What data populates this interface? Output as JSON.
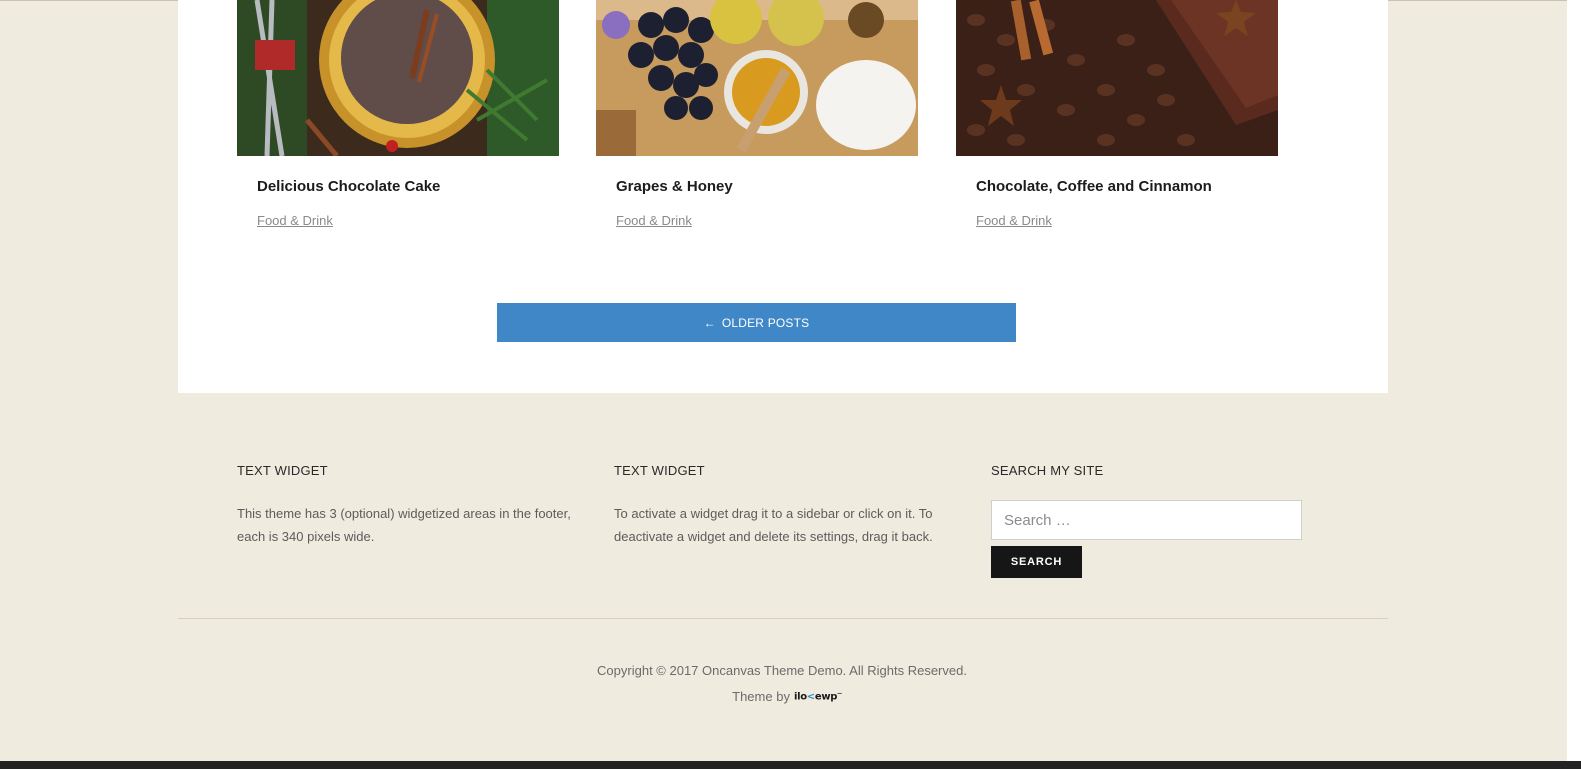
{
  "posts": [
    {
      "title": "Delicious Chocolate Cake",
      "category": "Food & Drink",
      "image": "chocolate-cake-photo"
    },
    {
      "title": "Grapes & Honey",
      "category": "Food & Drink",
      "image": "grapes-honey-photo"
    },
    {
      "title": "Chocolate, Coffee and Cinnamon",
      "category": "Food & Drink",
      "image": "coffee-cinnamon-photo"
    }
  ],
  "pagination": {
    "older_label": "OLDER POSTS",
    "arrow_icon": "arrow-left-icon"
  },
  "footer": {
    "widgets": [
      {
        "title": "TEXT WIDGET",
        "text": "This theme has 3 (optional) widgetized areas in the footer, each is 340 pixels wide."
      },
      {
        "title": "TEXT WIDGET",
        "text": "To activate a widget drag it to a sidebar or click on it. To deactivate a widget and delete its settings, drag it back."
      },
      {
        "title": "SEARCH MY SITE"
      }
    ],
    "search": {
      "placeholder": "Search …",
      "button_label": "SEARCH"
    },
    "copyright": "Copyright © 2017 Oncanvas Theme Demo. All Rights Reserved.",
    "theme_by_label": "Theme by",
    "brand_logo": "ilovewp"
  },
  "colors": {
    "page_bg": "#f0ebdf",
    "panel_bg": "#ffffff",
    "button_blue": "#3f87c7",
    "search_button": "#161616"
  }
}
